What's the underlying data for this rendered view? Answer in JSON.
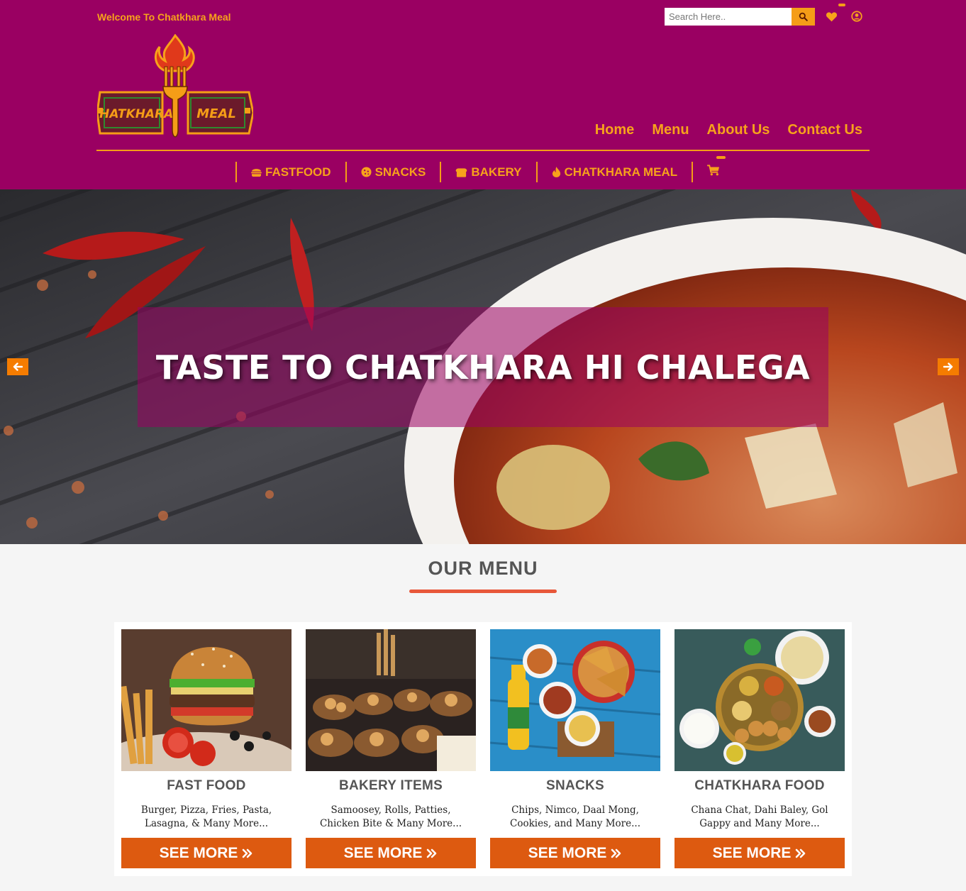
{
  "header": {
    "welcome": "Welcome To Chatkhara Meal",
    "search_placeholder": "Search Here..",
    "logo_text_left": "CHATKHARA",
    "logo_text_right": "MEAL"
  },
  "nav": {
    "home": "Home",
    "menu": "Menu",
    "about": "About Us",
    "contact": "Contact Us"
  },
  "categories": {
    "fastfood": "FASTFOOD",
    "snacks": "SNACKS",
    "bakery": "BAKERY",
    "chatkhara": "CHATKHARA MEAL"
  },
  "hero": {
    "caption": "TASTE TO CHATKHARA HI CHALEGA"
  },
  "menu_section": {
    "title": "OUR MENU",
    "cards": [
      {
        "title": "FAST FOOD",
        "desc": "Burger, Pizza, Fries, Pasta, Lasagna, & Many More...",
        "button": "SEE MORE"
      },
      {
        "title": "BAKERY ITEMS",
        "desc": "Samoosey, Rolls, Patties, Chicken Bite & Many More...",
        "button": "SEE MORE"
      },
      {
        "title": "SNACKS",
        "desc": "Chips, Nimco, Daal Mong, Cookies, and Many More...",
        "button": "SEE MORE"
      },
      {
        "title": "CHATKHARA FOOD",
        "desc": "Chana Chat, Dahi Baley, Gol Gappy and Many More...",
        "button": "SEE MORE"
      }
    ]
  },
  "colors": {
    "header_bg": "#9a0062",
    "accent": "#f7a21b",
    "button": "#dd5a10",
    "underline": "#e8573a"
  }
}
